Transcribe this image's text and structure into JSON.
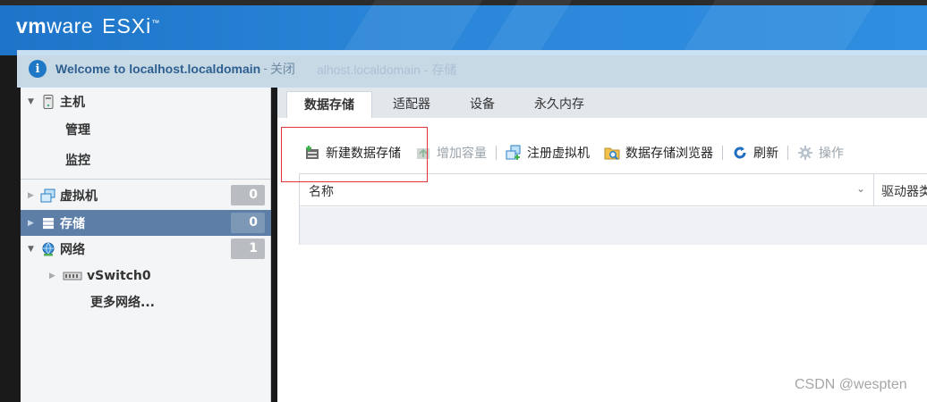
{
  "header": {
    "logo_vm": "vm",
    "logo_ware": "ware",
    "logo_product": "ESXi",
    "logo_tm": "™"
  },
  "banner": {
    "welcome_text": "Welcome to localhost.localdomain",
    "separator": "-",
    "close_label": "关闭",
    "ghost_text": "alhost.localdomain - 存储"
  },
  "navigator": {
    "host": {
      "label": "主机",
      "children": [
        "管理",
        "监控"
      ]
    },
    "vms": {
      "label": "虚拟机",
      "count": "0"
    },
    "storage": {
      "label": "存储",
      "count": "0"
    },
    "network": {
      "label": "网络",
      "count": "1",
      "children": [
        "vSwitch0",
        "更多网络..."
      ]
    }
  },
  "tabs": [
    "数据存储",
    "适配器",
    "设备",
    "永久内存"
  ],
  "active_tab": "数据存储",
  "toolbar": {
    "new_datastore": "新建数据存储",
    "increase_capacity": "增加容量",
    "register_vm": "注册虚拟机",
    "datastore_browser": "数据存储浏览器",
    "refresh": "刷新",
    "actions": "操作"
  },
  "grid": {
    "columns": [
      "名称",
      "驱动器类"
    ],
    "sort_indicator": "⌄"
  },
  "watermark": "CSDN @wespten",
  "colors": {
    "header_blue": "#2a86d8",
    "selected_nav": "#5d7fa7",
    "highlight_red": "#e0353a"
  }
}
